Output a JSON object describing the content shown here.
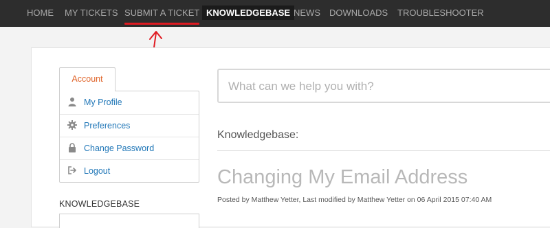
{
  "nav": {
    "items": [
      {
        "label": "HOME"
      },
      {
        "label": "MY TICKETS"
      },
      {
        "label": "SUBMIT A TICKET"
      },
      {
        "label": "KNOWLEDGEBASE"
      },
      {
        "label": "NEWS"
      },
      {
        "label": "DOWNLOADS"
      },
      {
        "label": "TROUBLESHOOTER"
      }
    ],
    "active_index": 3
  },
  "annotation": {
    "color": "#e01b22",
    "icon": "hand-drawn-arrow-up"
  },
  "sidebar": {
    "tab_label": "Account",
    "items": [
      {
        "label": "My Profile",
        "icon": "user-icon"
      },
      {
        "label": "Preferences",
        "icon": "gear-icon"
      },
      {
        "label": "Change Password",
        "icon": "lock-icon"
      },
      {
        "label": "Logout",
        "icon": "logout-icon"
      }
    ],
    "kb_heading": "KNOWLEDGEBASE"
  },
  "search": {
    "placeholder": "What can we help you with?",
    "value": ""
  },
  "main": {
    "section_label": "Knowledgebase:",
    "article_title": "Changing My Email Address",
    "byline": "Posted by Matthew Yetter, Last modified by Matthew Yetter on 06 April 2015 07:40 AM"
  },
  "colors": {
    "nav_bg": "#2d2d2d",
    "accent_orange": "#e0652b",
    "link_blue": "#1f76b7"
  }
}
